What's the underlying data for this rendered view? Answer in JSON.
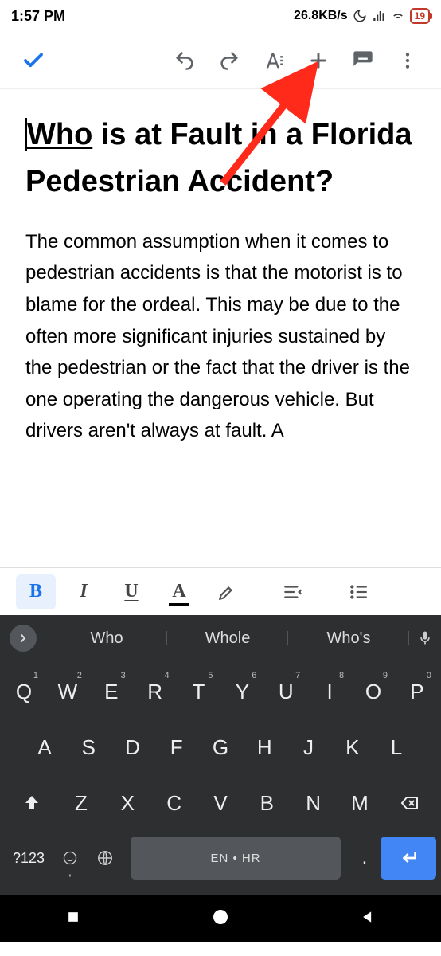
{
  "status": {
    "time": "1:57 PM",
    "net_speed": "26.8KB/s",
    "battery": "19"
  },
  "document": {
    "title_underlined_word": "Who",
    "title_rest": " is at Fault in a Florida Pedestrian Accident?",
    "body": "The common assumption when it comes to pedestrian accidents is that the motorist is to blame for the ordeal. This may be due to the often more significant injuries sustained by the pedestrian or the fact that the driver is the one operating the dangerous vehicle. But drivers aren't always at fault. A"
  },
  "fmt": {
    "bold": "B",
    "italic": "I",
    "underline": "U",
    "textcolor": "A"
  },
  "suggestions": {
    "w1": "Who",
    "w2": "Whole",
    "w3": "Who's"
  },
  "keyboard": {
    "row1": [
      "Q",
      "W",
      "E",
      "R",
      "T",
      "Y",
      "U",
      "I",
      "O",
      "P"
    ],
    "row1_sup": [
      "1",
      "2",
      "3",
      "4",
      "5",
      "6",
      "7",
      "8",
      "9",
      "0"
    ],
    "row2": [
      "A",
      "S",
      "D",
      "F",
      "G",
      "H",
      "J",
      "K",
      "L"
    ],
    "row3": [
      "Z",
      "X",
      "C",
      "V",
      "B",
      "N",
      "M"
    ],
    "symkey": "?123",
    "space_label": "EN • HR",
    "period": "."
  }
}
